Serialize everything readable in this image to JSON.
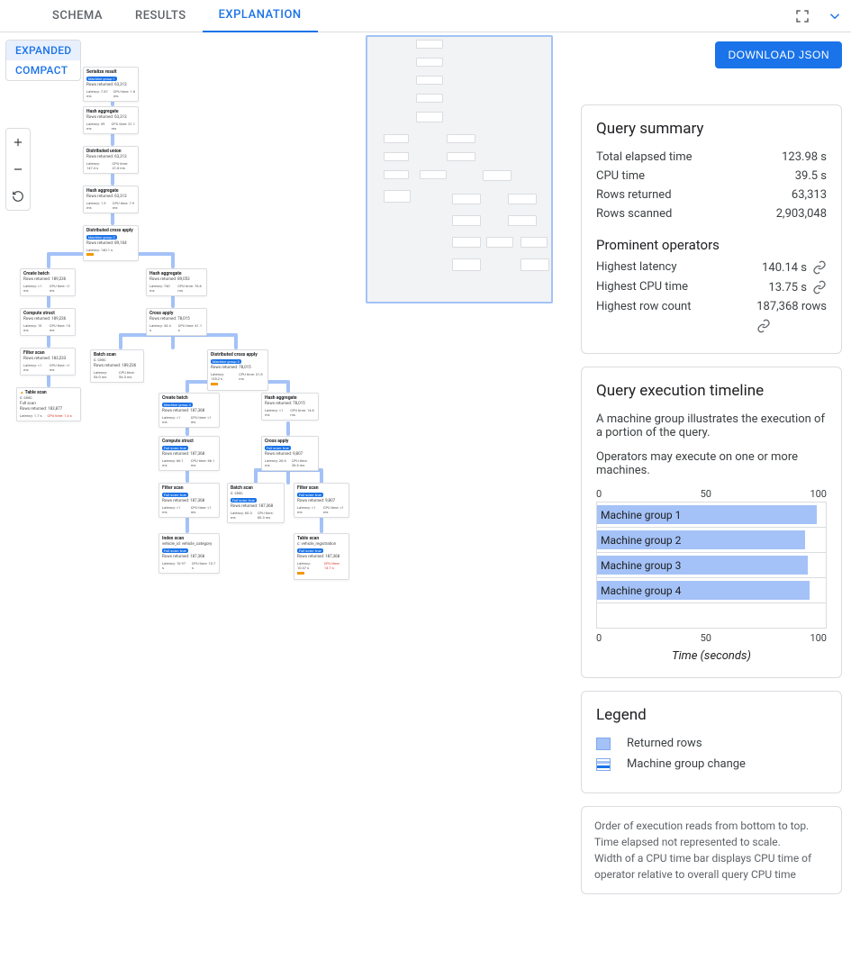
{
  "tabs": {
    "schema": "SCHEMA",
    "results": "RESULTS",
    "explanation": "EXPLANATION"
  },
  "density": {
    "expanded": "EXPANDED",
    "compact": "COMPACT"
  },
  "download_label": "DOWNLOAD JSON",
  "summary": {
    "title": "Query summary",
    "total_elapsed_k": "Total elapsed time",
    "total_elapsed_v": "123.98 s",
    "cpu_time_k": "CPU time",
    "cpu_time_v": "39.5 s",
    "rows_returned_k": "Rows returned",
    "rows_returned_v": "63,313",
    "rows_scanned_k": "Rows scanned",
    "rows_scanned_v": "2,903,048",
    "prominent_title": "Prominent operators",
    "highest_latency_k": "Highest latency",
    "highest_latency_v": "140.14 s",
    "highest_cpu_k": "Highest CPU time",
    "highest_cpu_v": "13.75 s",
    "highest_rows_k": "Highest row count",
    "highest_rows_v": "187,368 rows"
  },
  "timeline": {
    "title": "Query execution timeline",
    "desc1": "A machine group illustrates the execution of a portion of the query.",
    "desc2": "Operators may execute on one or more machines.",
    "axis_min": "0",
    "axis_mid": "50",
    "axis_max": "100",
    "rows": [
      {
        "label": "Machine group 1",
        "pct": 96
      },
      {
        "label": "Machine group 2",
        "pct": 91
      },
      {
        "label": "Machine group 3",
        "pct": 92
      },
      {
        "label": "Machine group 4",
        "pct": 93
      }
    ],
    "xcaption": "Time (seconds)"
  },
  "legend": {
    "title": "Legend",
    "returned_rows": "Returned rows",
    "machine_group_change": "Machine group change"
  },
  "notes": {
    "n1": "Order of execution reads from bottom to top.",
    "n2": "Time elapsed not represented to scale.",
    "n3": "Width of a CPU time bar displays CPU time of operator relative to overall query CPU time"
  },
  "nodes": {
    "serialize": {
      "title": "Serialize result",
      "pill": "Machine group 1",
      "rows": "Rows returned: 63,313",
      "lat": "Latency: 7.87 ms",
      "cpu": "CPU time: 1.8 ms"
    },
    "hashagg1": {
      "title": "Hash aggregate",
      "rows": "Rows returned: 63,313",
      "lat": "Latency: 39 ms",
      "cpu": "CPU time: 21.1 ms"
    },
    "distunion": {
      "title": "Distributed union",
      "rows": "Rows returned: 63,313",
      "lat": "Latency: 147.4 s",
      "cpu": "CPU time: 41.8 ms"
    },
    "hashagg2": {
      "title": "Hash aggregate",
      "rows": "Rows returned: 63,313",
      "lat": "Latency: 1.9 ms",
      "cpu": "CPU time: 7.9 ms"
    },
    "distcross1": {
      "title": "Distributed cross apply",
      "pill": "Machine group 2",
      "rows": "Rows returned: 89,164",
      "lat": "Latency: 140.1 s"
    },
    "createbatch1": {
      "title": "Create batch",
      "rows": "Rows returned: 189,236",
      "lat": "Latency: <1 ms",
      "cpu": "CPU time: <1 ms"
    },
    "computestruct1": {
      "title": "Compute struct",
      "rows": "Rows returned: 189,236",
      "lat": "Latency: 10 ms",
      "cpu": "CPU time: 10 ms"
    },
    "filterscan1": {
      "title": "Filter scan",
      "rows": "Rows returned: 183,233",
      "lat": "Latency: <1 ms",
      "cpu": "CPU time: <1 ms"
    },
    "tablescan1": {
      "title": "Table scan",
      "sub": "c: civic\nFull scan",
      "rows": "Rows returned: 183,877",
      "lat": "Latency: 1.7 s",
      "cpu": "CPU time: 1.4 s"
    },
    "hashagg3": {
      "title": "Hash aggregate",
      "rows": "Rows returned: 89,053",
      "lat": "Latency: 740 ms",
      "cpu": "CPU time: 76.6 ms"
    },
    "crossapply1": {
      "title": "Cross apply",
      "rows": "Rows returned: 78,015",
      "lat": "Latency: 33.4 s",
      "cpu": "CPU time: 41.1 s"
    },
    "batchscan1": {
      "title": "Batch scan",
      "sub": "c: civic",
      "rows": "Rows returned: 189,236",
      "lat": "Latency: 54.0 ms",
      "cpu": "CPU time: 54.0 ms"
    },
    "distcross2": {
      "title": "Distributed cross apply",
      "pill": "Machine group 3",
      "rows": "Rows returned: 78,015",
      "lat": "Latency: 135.2 s",
      "cpu": "CPU time: 31.8 ms"
    },
    "createbatch2": {
      "title": "Create batch",
      "pill": "Machine group 4",
      "rows": "Rows returned: 187,368",
      "lat": "Latency: <1 ms",
      "cpu": "CPU time: <1 ms"
    },
    "computestruct2": {
      "title": "Compute struct",
      "pill": "Full scan: true",
      "rows": "Rows returned: 187,368",
      "lat": "Latency: 66.1 ms",
      "cpu": "CPU time: 66.1 ms"
    },
    "filterscan2": {
      "title": "Filter scan",
      "pill": "Full scan: true",
      "rows": "Rows returned: 187,368",
      "lat": "Latency: <1 ms",
      "cpu": "CPU time: <1 ms"
    },
    "indexscan": {
      "title": "Index scan",
      "sub": "vehicle_id: vehicle_category",
      "pill": "Full scan: true",
      "rows": "Rows returned: 187,368",
      "lat": "Latency: 10.97 s",
      "cpu": "CPU time: 10.7 s"
    },
    "hashagg4": {
      "title": "Hash aggregate",
      "rows": "Rows returned: 78,015",
      "lat": "Latency: <1 ms",
      "cpu": "CPU time: 14.6 ms"
    },
    "crossapply2": {
      "title": "Cross apply",
      "pill": "Full scan: true",
      "rows": "Rows returned: 9,807",
      "lat": "Latency: 26.6 ms",
      "cpu": "CPU time: 26.6 ms"
    },
    "batchscan2": {
      "title": "Batch scan",
      "sub": "c: civic",
      "pill": "Full scan: true",
      "rows": "Rows returned: 187,368",
      "lat": "Latency: 60.3 ms",
      "cpu": "CPU time: 60.3 ms"
    },
    "filterscan3": {
      "title": "Filter scan",
      "pill": "Full scan: true",
      "rows": "Rows returned: 9,807",
      "lat": "Latency: <1 ms",
      "cpu": "CPU time: <1 ms"
    },
    "tablescan2": {
      "title": "Table scan",
      "sub": "c: vehicle_registration",
      "pill": "Full scan: true",
      "rows": "Rows returned: 187,368",
      "lat": "Latency: 10.37 s",
      "cpu": "CPU time: 13.7 s"
    }
  }
}
